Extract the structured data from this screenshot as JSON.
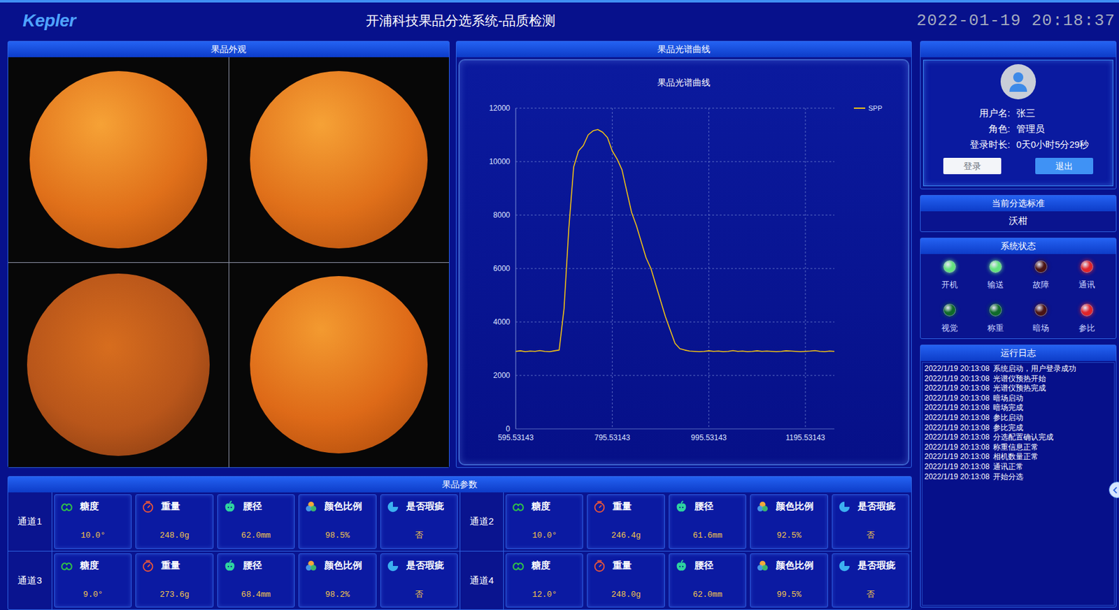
{
  "header": {
    "logo": "Kepler",
    "title": "开浦科技果品分选系统-品质检测",
    "datetime": "2022-01-19 20:18:37"
  },
  "appearance": {
    "title": "果品外观"
  },
  "spectrum": {
    "panel_title": "果品光谱曲线",
    "chart": {
      "title": "果品光谱曲线",
      "legend": [
        {
          "label": "SPP",
          "color": "#f2c314"
        }
      ],
      "y_axis": {
        "min": 0,
        "max": 12000,
        "ticks": [
          "0",
          "2000",
          "4000",
          "6000",
          "8000",
          "10000",
          "12000"
        ]
      },
      "x_axis": {
        "min": 595.53143,
        "max": 1255.53143,
        "ticks": [
          "595.53143",
          "795.53143",
          "995.53143",
          "1195.53143"
        ]
      },
      "series": [
        {
          "name": "SPP",
          "color": "#f2c314",
          "x_start": 595.53143,
          "x_step": 10,
          "values": [
            2900,
            2920,
            2890,
            2910,
            2900,
            2930,
            2900,
            2890,
            2920,
            2950,
            4500,
            7500,
            9800,
            10400,
            10600,
            11000,
            11150,
            11200,
            11100,
            10900,
            10400,
            10100,
            9700,
            8900,
            8100,
            7600,
            7000,
            6400,
            6000,
            5400,
            4800,
            4200,
            3700,
            3200,
            3000,
            2950,
            2910,
            2900,
            2890,
            2900,
            2920,
            2900,
            2910,
            2890,
            2900,
            2930,
            2900,
            2910,
            2890,
            2900,
            2920,
            2900,
            2910,
            2900,
            2890,
            2900,
            2920,
            2910,
            2900,
            2890,
            2900,
            2910,
            2930,
            2900,
            2890,
            2910,
            2900
          ]
        }
      ]
    }
  },
  "user": {
    "fields": [
      {
        "label": "用户名:",
        "value": "张三"
      },
      {
        "label": "角色:",
        "value": "管理员"
      },
      {
        "label": "登录时长:",
        "value": "0天0小时5分29秒"
      }
    ],
    "buttons": [
      {
        "label": "登录",
        "kind": "secondary"
      },
      {
        "label": "退出",
        "kind": "primary"
      }
    ]
  },
  "standard": {
    "title": "当前分选标准",
    "value": "沃柑"
  },
  "status": {
    "title": "系统状态",
    "lights": [
      {
        "label": "开机",
        "color": "#63e27e"
      },
      {
        "label": "输送",
        "color": "#63e27e"
      },
      {
        "label": "故障",
        "color": "#4a1414"
      },
      {
        "label": "通讯",
        "color": "#e0242a"
      },
      {
        "label": "视觉",
        "color": "#0f6a2a"
      },
      {
        "label": "称重",
        "color": "#0f6a2a"
      },
      {
        "label": "暗场",
        "color": "#4a1414"
      },
      {
        "label": "参比",
        "color": "#e0242a"
      }
    ]
  },
  "log": {
    "title": "运行日志",
    "entries": [
      {
        "time": "2022/1/19 20:13:08",
        "message": "系统启动，用户登录成功"
      },
      {
        "time": "2022/1/19 20:13:08",
        "message": "光谱仪预热开始"
      },
      {
        "time": "2022/1/19 20:13:08",
        "message": "光谱仪预热完成"
      },
      {
        "time": "2022/1/19 20:13:08",
        "message": "暗场启动"
      },
      {
        "time": "2022/1/19 20:13:08",
        "message": "暗场完成"
      },
      {
        "time": "2022/1/19 20:13:08",
        "message": "参比启动"
      },
      {
        "time": "2022/1/19 20:13:08",
        "message": "参比完成"
      },
      {
        "time": "2022/1/19 20:13:08",
        "message": "分选配置确认完成"
      },
      {
        "time": "2022/1/19 20:13:08",
        "message": "称重信息正常"
      },
      {
        "time": "2022/1/19 20:13:08",
        "message": "相机数量正常"
      },
      {
        "time": "2022/1/19 20:13:08",
        "message": "通讯正常"
      },
      {
        "time": "2022/1/19 20:13:08",
        "message": "开始分选"
      }
    ]
  },
  "params": {
    "title": "果品参数",
    "channels": [
      {
        "name": "通道1",
        "items": [
          {
            "kind": "sugar",
            "label": "糖度",
            "value": "10.0°"
          },
          {
            "kind": "weight",
            "label": "重量",
            "value": "248.0g"
          },
          {
            "kind": "diameter",
            "label": "腰径",
            "value": "62.0mm"
          },
          {
            "kind": "color",
            "label": "颜色比例",
            "value": "98.5%"
          },
          {
            "kind": "defect",
            "label": "是否瑕疵",
            "value": "否"
          }
        ]
      },
      {
        "name": "通道2",
        "items": [
          {
            "kind": "sugar",
            "label": "糖度",
            "value": "10.0°"
          },
          {
            "kind": "weight",
            "label": "重量",
            "value": "246.4g"
          },
          {
            "kind": "diameter",
            "label": "腰径",
            "value": "61.6mm"
          },
          {
            "kind": "color",
            "label": "颜色比例",
            "value": "92.5%"
          },
          {
            "kind": "defect",
            "label": "是否瑕疵",
            "value": "否"
          }
        ]
      },
      {
        "name": "通道3",
        "items": [
          {
            "kind": "sugar",
            "label": "糖度",
            "value": "9.0°"
          },
          {
            "kind": "weight",
            "label": "重量",
            "value": "273.6g"
          },
          {
            "kind": "diameter",
            "label": "腰径",
            "value": "68.4mm"
          },
          {
            "kind": "color",
            "label": "颜色比例",
            "value": "98.2%"
          },
          {
            "kind": "defect",
            "label": "是否瑕疵",
            "value": "否"
          }
        ]
      },
      {
        "name": "通道4",
        "items": [
          {
            "kind": "sugar",
            "label": "糖度",
            "value": "12.0°"
          },
          {
            "kind": "weight",
            "label": "重量",
            "value": "248.0g"
          },
          {
            "kind": "diameter",
            "label": "腰径",
            "value": "62.0mm"
          },
          {
            "kind": "color",
            "label": "颜色比例",
            "value": "99.5%"
          },
          {
            "kind": "defect",
            "label": "是否瑕疵",
            "value": "否"
          }
        ]
      }
    ]
  }
}
